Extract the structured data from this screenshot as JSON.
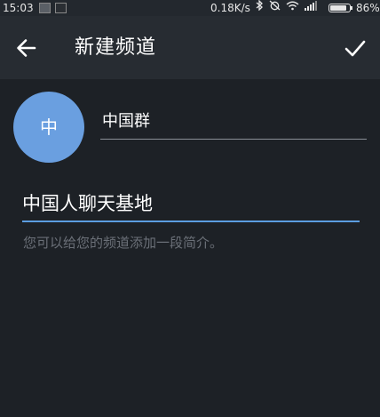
{
  "status_bar": {
    "time": "15:03",
    "net_speed": "0.18K/s",
    "battery_percent_text": "86%",
    "battery_level": 0.86,
    "icons": [
      "notification-icon",
      "notification-icon",
      "bluetooth-icon",
      "alarm-off-icon",
      "wifi-icon",
      "signal-icon",
      "battery-icon"
    ]
  },
  "toolbar": {
    "title": "新建频道",
    "back_icon": "arrow-left-icon",
    "done_icon": "check-icon"
  },
  "channel": {
    "avatar_letter": "中",
    "avatar_color": "#6a9fe0",
    "name_value": "中国群",
    "description_value": "中国人聊天基地",
    "description_hint": "您可以给您的频道添加一段简介。"
  },
  "colors": {
    "background": "#1d2126",
    "toolbar": "#272c32",
    "accent_underline": "#5c9de0"
  }
}
